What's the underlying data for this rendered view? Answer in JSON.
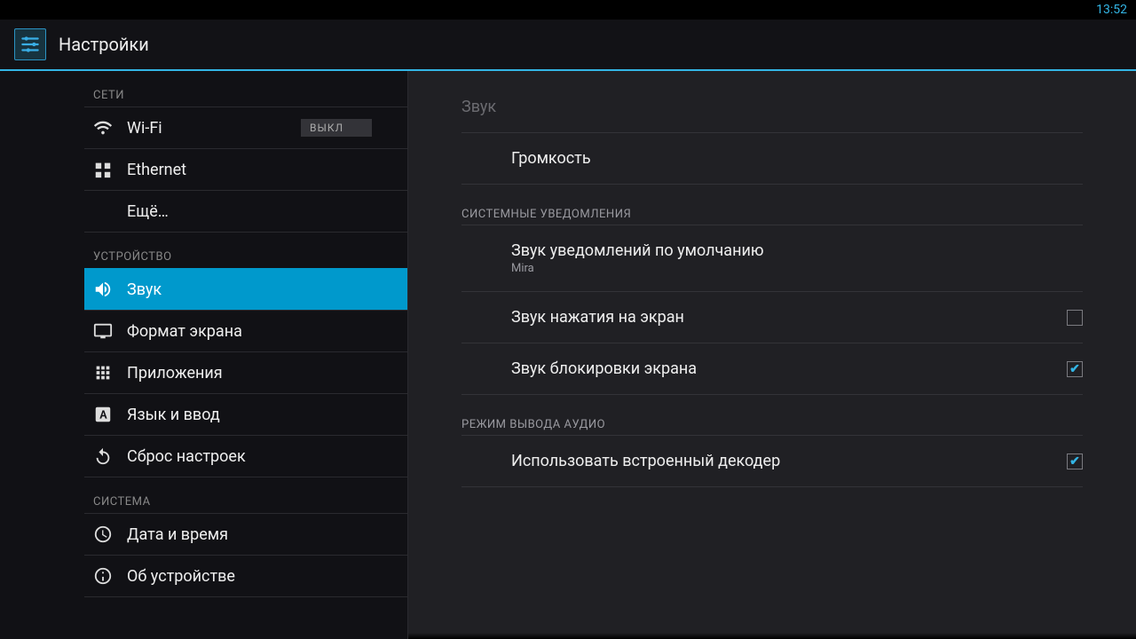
{
  "statusbar": {
    "time": "13:52"
  },
  "header": {
    "title": "Настройки"
  },
  "sidebar": {
    "cat_networks": "СЕТИ",
    "wifi": "Wi-Fi",
    "wifi_off": "ВЫКЛ",
    "ethernet": "Ethernet",
    "more": "Ещё…",
    "cat_device": "УСТРОЙСТВО",
    "sound": "Звук",
    "display": "Формат экрана",
    "apps": "Приложения",
    "lang": "Язык и ввод",
    "reset": "Сброс настроек",
    "cat_system": "СИСТЕМА",
    "datetime": "Дата и время",
    "about": "Об устройстве"
  },
  "content": {
    "title": "Звук",
    "volume": "Громкость",
    "section_notif": "СИСТЕМНЫЕ УВЕДОМЛЕНИЯ",
    "notif_sound": "Звук уведомлений по умолчанию",
    "notif_sound_sub": "Mira",
    "touch_sound": "Звук нажатия на экран",
    "lock_sound": "Звук блокировки экрана",
    "section_audio": "РЕЖИМ ВЫВОДА АУДИО",
    "decoder": "Использовать встроенный декодер"
  }
}
